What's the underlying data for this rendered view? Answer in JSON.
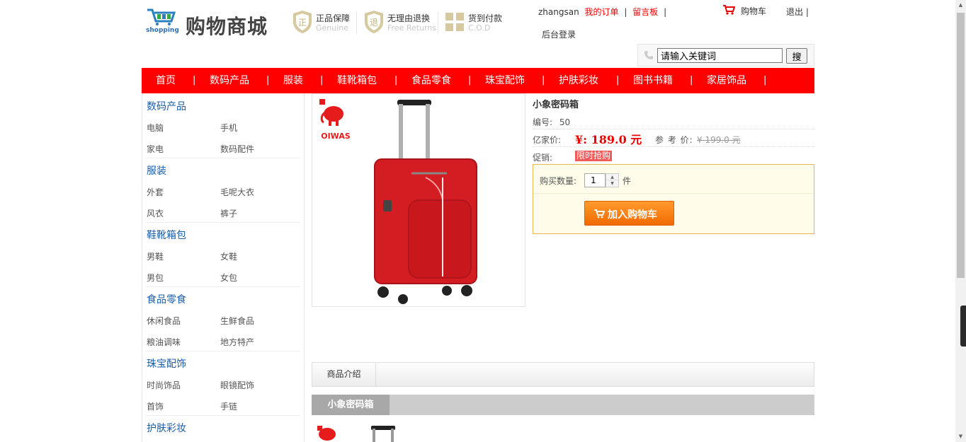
{
  "header": {
    "logo_text": "购物商城",
    "logo_sub": "shopping",
    "guarantees": [
      {
        "title": "正品保障",
        "sub": "Genuine",
        "icon": "shield-zheng-icon"
      },
      {
        "title": "无理由退换",
        "sub": "Free Returns",
        "icon": "shield-tui-icon"
      },
      {
        "title": "货到付款",
        "sub": "C.O.D",
        "icon": "package-icon"
      }
    ],
    "username": "zhangsan",
    "my_orders": "我的订单",
    "sep": "|",
    "message_board": "留言板",
    "admin_login": "后台登录",
    "cart": "购物车",
    "logout": "退出 |"
  },
  "search": {
    "value": "请输入关键词",
    "button": "搜"
  },
  "nav": {
    "items": [
      "首页",
      "数码产品",
      "服装",
      "鞋靴箱包",
      "食品零食",
      "珠宝配饰",
      "护肤彩妆",
      "图书书籍",
      "家居饰品"
    ],
    "sep": "|"
  },
  "categories": [
    {
      "title": "数码产品",
      "links": [
        "电脑",
        "手机",
        "家电",
        "数码配件"
      ]
    },
    {
      "title": "服装",
      "links": [
        "外套",
        "毛呢大衣",
        "风衣",
        "裤子"
      ]
    },
    {
      "title": "鞋靴箱包",
      "links": [
        "男鞋",
        "女鞋",
        "男包",
        "女包"
      ]
    },
    {
      "title": "食品零食",
      "links": [
        "休闲食品",
        "生鲜食品",
        "粮油调味",
        "地方特产"
      ]
    },
    {
      "title": "珠宝配饰",
      "links": [
        "时尚饰品",
        "眼镜配饰",
        "首饰",
        "手链"
      ]
    },
    {
      "title": "护肤彩妆",
      "links": []
    }
  ],
  "product": {
    "name": "小象密码箱",
    "code_label": "编号:",
    "code": "50",
    "price_label": "亿家价:",
    "price": "¥:  189.0 元",
    "ref_label": "参 考 价:",
    "ref_price": "¥ 199.0 元",
    "promo_label": "促销:",
    "promo_badge": "限时抢购",
    "qty_label": "购买数量:",
    "qty": "1",
    "unit": "件",
    "add_to_cart": "加入购物车",
    "brand": "OIWAS"
  },
  "tabs": {
    "intro": "商品介绍",
    "section_title": "小象密码箱"
  },
  "colors": {
    "nav_red": "#ff0000",
    "price_red": "#ee0000",
    "cart_orange": "#f47a10",
    "link_blue": "#1a5ea8"
  }
}
